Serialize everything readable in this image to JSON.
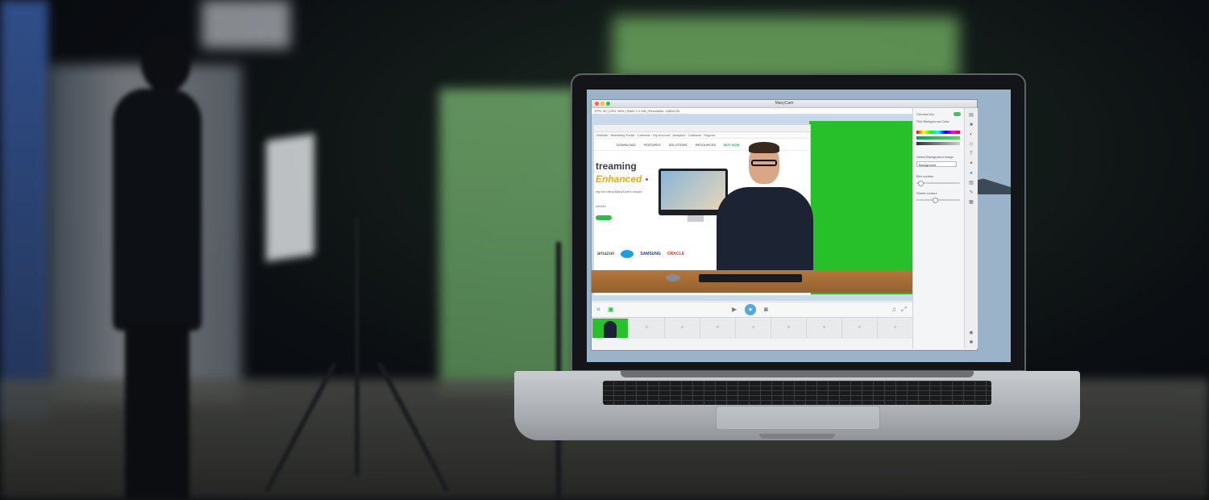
{
  "app": {
    "window_title": "ManyCam",
    "stats": "FPS: 30 | CPU: 56% | RAM: 1.2 GB | Resolution: 1280x720"
  },
  "webpage": {
    "bookmarks": "Website  ·  Marketing Portal  ·  Calendar  ·  My Account  ·  Analytics  ·  Contacts  ·  Support",
    "nav": [
      "DOWNLOAD",
      "FEATURES",
      "SOLUTIONS",
      "RESOURCES",
      "BUY NOW"
    ],
    "headline_1": "treaming",
    "headline_2": "Enhanced",
    "subtext": "ing fun using ManyCam's simple",
    "small_text": "wnload",
    "brands": [
      "amazon",
      "SAMSUNG",
      "ORACLE"
    ]
  },
  "side_panel": {
    "chroma_key": "Chroma key",
    "pick_color": "Pick Background Color",
    "select_bg": "Select Background Image",
    "bg_option": "Background",
    "blur_contour": "Blur contour",
    "shrink_contour": "Shrink contour"
  },
  "toolbar": {
    "capture_icon": "camera-icon",
    "video_icon": "video-icon"
  },
  "filmstrip": {
    "slots": [
      "+",
      "+",
      "+",
      "+",
      "+",
      "+",
      "+",
      "+"
    ]
  },
  "colors": {
    "chroma_green": "#27c02a",
    "accent_blue": "#53a8e2",
    "cta_green": "#28c044",
    "brand_orange": "#f0a613"
  }
}
